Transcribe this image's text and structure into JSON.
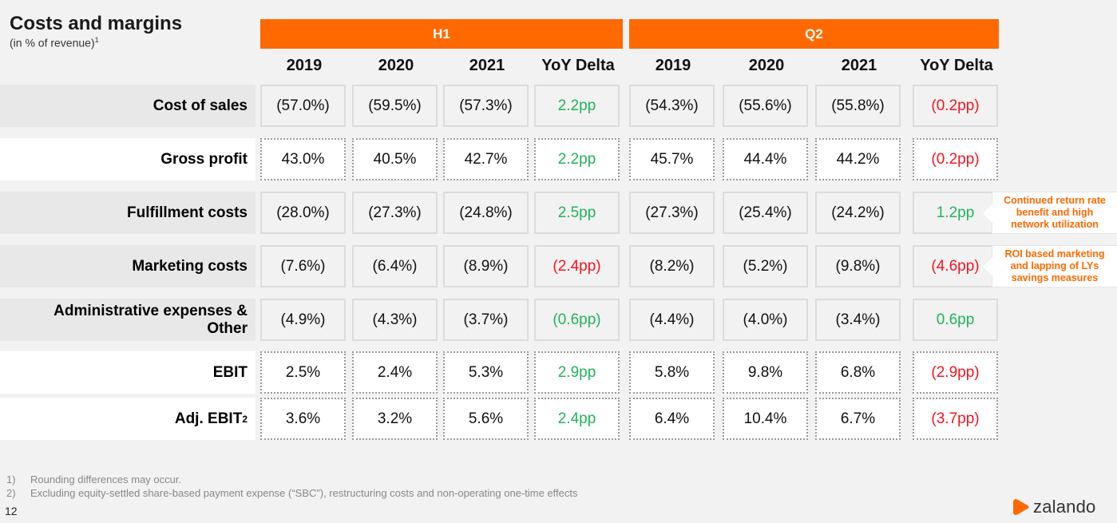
{
  "header": {
    "title": "Costs and margins",
    "subtitle": "(in % of revenue)",
    "subtitle_footnote": "1"
  },
  "groups": [
    {
      "label": "H1",
      "columns": [
        "2019",
        "2020",
        "2021",
        "YoY Delta"
      ]
    },
    {
      "label": "Q2",
      "columns": [
        "2019",
        "2020",
        "2021",
        "YoY Delta"
      ]
    }
  ],
  "rows": [
    {
      "label": "Cost of sales",
      "footnote": "",
      "style": "shaded",
      "h1": [
        "(57.0%)",
        "(59.5%)",
        "(57.3%)"
      ],
      "h1_delta": "2.2pp",
      "h1_delta_sign": "pos",
      "q2": [
        "(54.3%)",
        "(55.6%)",
        "(55.8%)"
      ],
      "q2_delta": "(0.2pp)",
      "q2_delta_sign": "neg"
    },
    {
      "label": "Gross profit",
      "footnote": "",
      "style": "white",
      "h1": [
        "43.0%",
        "40.5%",
        "42.7%"
      ],
      "h1_delta": "2.2pp",
      "h1_delta_sign": "pos",
      "q2": [
        "45.7%",
        "44.4%",
        "44.2%"
      ],
      "q2_delta": "(0.2pp)",
      "q2_delta_sign": "neg"
    },
    {
      "label": "Fulfillment costs",
      "footnote": "",
      "style": "shaded",
      "h1": [
        "(28.0%)",
        "(27.3%)",
        "(24.8%)"
      ],
      "h1_delta": "2.5pp",
      "h1_delta_sign": "pos",
      "q2": [
        "(27.3%)",
        "(25.4%)",
        "(24.2%)"
      ],
      "q2_delta": "1.2pp",
      "q2_delta_sign": "pos"
    },
    {
      "label": "Marketing costs",
      "footnote": "",
      "style": "shaded",
      "h1": [
        "(7.6%)",
        "(6.4%)",
        "(8.9%)"
      ],
      "h1_delta": "(2.4pp)",
      "h1_delta_sign": "neg",
      "q2": [
        "(8.2%)",
        "(5.2%)",
        "(9.8%)"
      ],
      "q2_delta": "(4.6pp)",
      "q2_delta_sign": "neg"
    },
    {
      "label": "Administrative expenses & Other",
      "footnote": "",
      "style": "shaded",
      "h1": [
        "(4.9%)",
        "(4.3%)",
        "(3.7%)"
      ],
      "h1_delta": "(0.6pp)",
      "h1_delta_sign": "pos",
      "q2": [
        "(4.4%)",
        "(4.0%)",
        "(3.4%)"
      ],
      "q2_delta": "0.6pp",
      "q2_delta_sign": "pos"
    },
    {
      "label": "EBIT",
      "footnote": "",
      "style": "white",
      "h1": [
        "2.5%",
        "2.4%",
        "5.3%"
      ],
      "h1_delta": "2.9pp",
      "h1_delta_sign": "pos",
      "q2": [
        "5.8%",
        "9.8%",
        "6.8%"
      ],
      "q2_delta": "(2.9pp)",
      "q2_delta_sign": "neg"
    },
    {
      "label": "Adj. EBIT",
      "footnote": "2",
      "style": "white",
      "h1": [
        "3.6%",
        "3.2%",
        "5.6%"
      ],
      "h1_delta": "2.4pp",
      "h1_delta_sign": "pos",
      "q2": [
        "6.4%",
        "10.4%",
        "6.7%"
      ],
      "q2_delta": "(3.7pp)",
      "q2_delta_sign": "neg"
    }
  ],
  "callouts": [
    {
      "row": 2,
      "text": "Continued return rate\nbenefit and high\nnetwork utilization"
    },
    {
      "row": 3,
      "text": "ROI based marketing\nand lapping of LYs\nsavings measures"
    }
  ],
  "footnotes": [
    {
      "num": "1)",
      "text": "Rounding differences may occur."
    },
    {
      "num": "2)",
      "text": "Excluding equity-settled share-based payment expense (“SBC”), restructuring costs and non-operating one-time effects"
    }
  ],
  "page_number": "12",
  "logo": {
    "name": "zalando-logo",
    "text": "zalando",
    "color": "#ff6900"
  },
  "colors": {
    "accent": "#ff6900",
    "positive": "#22b35a",
    "negative": "#f5141e"
  }
}
